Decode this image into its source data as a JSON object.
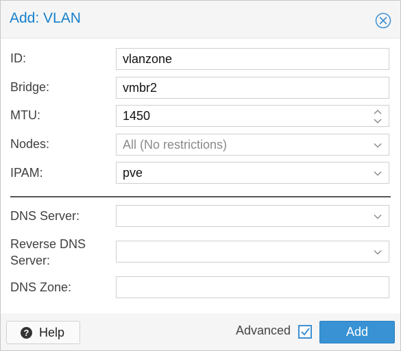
{
  "dialog": {
    "title": "Add: VLAN",
    "close_icon": "close-circle-icon"
  },
  "fields": [
    {
      "label": "ID:",
      "value": "vlanzone",
      "type": "text"
    },
    {
      "label": "Bridge:",
      "value": "vmbr2",
      "type": "text"
    },
    {
      "label": "MTU:",
      "value": "1450",
      "type": "number"
    },
    {
      "label": "Nodes:",
      "value": "All (No restrictions)",
      "type": "select",
      "placeholder": true
    },
    {
      "label": "IPAM:",
      "value": "pve",
      "type": "select"
    }
  ],
  "dns_fields": [
    {
      "label": "DNS Server:",
      "value": "",
      "type": "select"
    },
    {
      "label_line1": "Reverse DNS",
      "label_line2": "Server:",
      "value": "",
      "type": "select"
    },
    {
      "label": "DNS Zone:",
      "value": "",
      "type": "text"
    }
  ],
  "footer": {
    "help_label": "Help",
    "help_icon": "question-circle-icon",
    "advanced_label": "Advanced",
    "advanced_checked": true,
    "add_label": "Add"
  },
  "colors": {
    "title": "#157fcc",
    "primary_button": "#3892d4",
    "checkbox": "#3c8fd3"
  }
}
